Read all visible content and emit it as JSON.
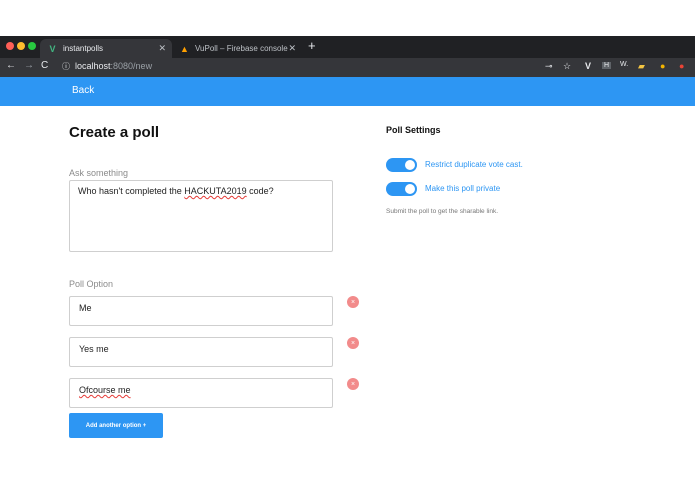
{
  "browser": {
    "tabs": [
      {
        "title": "instantpolls",
        "favicon": "vue-icon"
      },
      {
        "title": "VuPoll – Firebase console",
        "favicon": "firebase-icon"
      }
    ],
    "url_host": "localhost",
    "url_path": ":8080/new",
    "extensions": [
      "key-icon",
      "star-icon",
      "v-icon",
      "h-icon",
      "w-icon",
      "extension-icon",
      "avatar-icon",
      "alert-icon"
    ]
  },
  "appbar": {
    "back_label": "Back"
  },
  "page": {
    "title": "Create a poll",
    "question_label": "Ask something",
    "question_prefix": "Who hasn't completed the ",
    "question_highlight": "HACKUTA2019",
    "question_suffix": " code?",
    "option_label": "Poll Option",
    "options": [
      "Me",
      "Yes me",
      "Ofcourse me"
    ],
    "remove_icon": "×",
    "add_option_label": "Add another option +"
  },
  "settings": {
    "title": "Poll Settings",
    "toggles": [
      {
        "label": "Restrict duplicate vote cast.",
        "on": true
      },
      {
        "label": "Make this poll private",
        "on": true
      }
    ],
    "hint": "Submit the poll to get the sharable link."
  },
  "colors": {
    "accent": "#2d96f3",
    "remove": "#f28b8b",
    "chrome_dark": "#202124"
  }
}
